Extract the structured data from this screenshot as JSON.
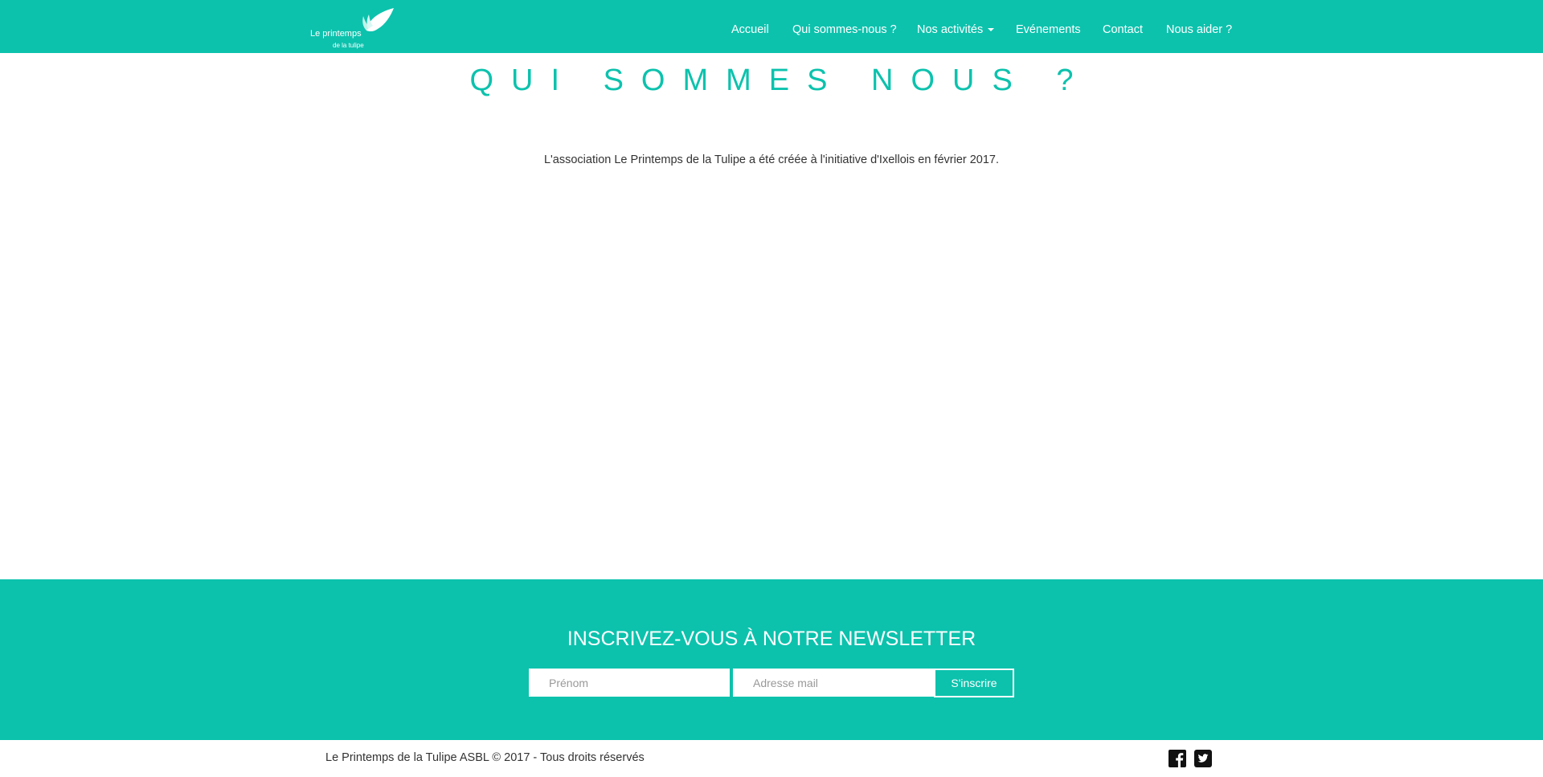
{
  "brand": {
    "logo_line1": "Le printemps",
    "logo_line2": "de la tulipe",
    "logo_icon": "wing-icon"
  },
  "nav": {
    "items": [
      {
        "label": "Accueil"
      },
      {
        "label": "Qui sommes-nous ?"
      },
      {
        "label": "Nos activités",
        "has_dropdown": true
      },
      {
        "label": "Evénements"
      },
      {
        "label": "Contact"
      },
      {
        "label": "Nous aider ?"
      }
    ]
  },
  "main": {
    "title": "QUI SOMMES NOUS ?",
    "intro": "L'association Le Printemps de la Tulipe a été créée à l'initiative d'Ixellois en février 2017."
  },
  "newsletter": {
    "title": "INSCRIVEZ-VOUS À NOTRE NEWSLETTER",
    "firstname_placeholder": "Prénom",
    "email_placeholder": "Adresse mail",
    "submit_label": "S'inscrire"
  },
  "footer": {
    "copyright": "Le Printemps de la Tulipe ASBL © 2017 - Tous droits réservés",
    "social": [
      "facebook-icon",
      "twitter-icon"
    ]
  },
  "colors": {
    "accent": "#0cc2ad",
    "text": "#333333",
    "background": "#ffffff"
  }
}
